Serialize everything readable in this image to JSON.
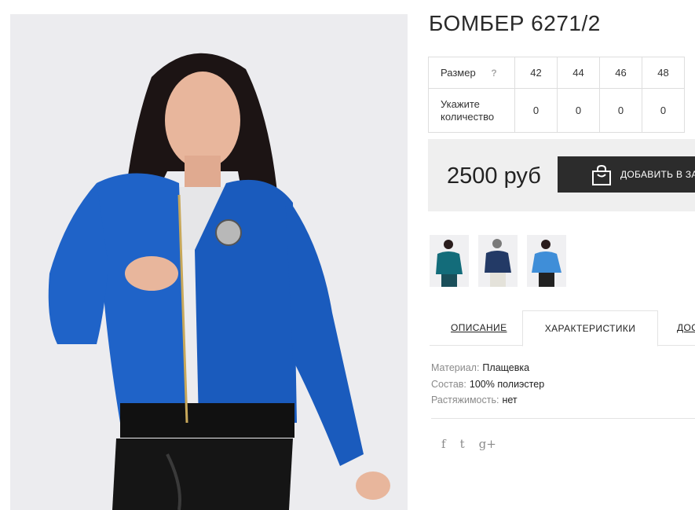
{
  "product": {
    "title": "БОМБЕР 6271/2",
    "image_alt": "Woman in blue bomber jacket"
  },
  "size_table": {
    "size_label": "Размер",
    "help": "?",
    "sizes": [
      "42",
      "44",
      "46",
      "48"
    ],
    "qty_label": "Укажите количество",
    "quantities": [
      "0",
      "0",
      "0",
      "0"
    ]
  },
  "purchase": {
    "price": "2500 руб",
    "add_to_cart": "ДОБАВИТЬ В ЗАКАЗ"
  },
  "thumbnails": [
    {
      "name": "teal"
    },
    {
      "name": "navy"
    },
    {
      "name": "blue"
    }
  ],
  "tabs": [
    "ОПИСАНИЕ",
    "ХАРАКТЕРИСТИКИ",
    "ДОСТАВКА"
  ],
  "specs": [
    {
      "key": "Материал:",
      "value": "Плащевка"
    },
    {
      "key": "Состав:",
      "value": "100% полиэстер"
    },
    {
      "key": "Растяжимость:",
      "value": "нет"
    }
  ],
  "social": [
    {
      "icon": "facebook-icon",
      "glyph": "f"
    },
    {
      "icon": "twitter-icon",
      "glyph": "t"
    },
    {
      "icon": "google-plus-icon",
      "glyph": "g+"
    }
  ],
  "colors": {
    "jacket": "#1f63c8",
    "dark": "#2c2c2c",
    "bar": "#efefef"
  }
}
